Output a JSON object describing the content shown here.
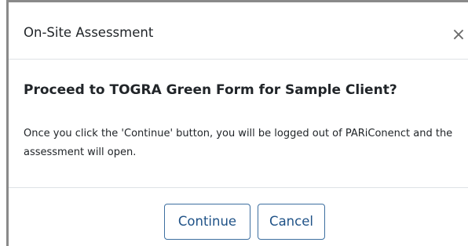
{
  "dialog": {
    "title": "On-Site Assessment",
    "close_glyph": "×",
    "question": "Proceed to TOGRA Green Form for Sample Client?",
    "message": "Once you click the 'Continue' button, you will be logged out of PARiConenct and the assessment will open.",
    "buttons": {
      "continue_label": "Continue",
      "cancel_label": "Cancel"
    }
  },
  "colors": {
    "button_border": "#3d6fa0",
    "button_text": "#1f5287",
    "divider": "#dee2e6",
    "text": "#212529"
  },
  "icons": {
    "close": "close-icon"
  }
}
